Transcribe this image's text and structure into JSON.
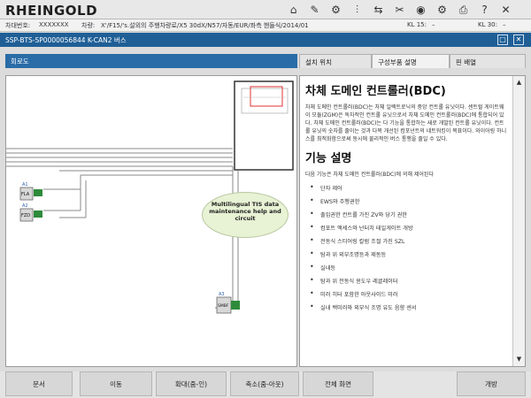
{
  "app": {
    "brand": "RHEINGOLD"
  },
  "toolbar": {
    "icons": [
      "home-icon",
      "wrench-icon",
      "car-icon",
      "chart-icon",
      "swap-icon",
      "tools-icon",
      "camera-icon",
      "gear-icon",
      "printer-icon",
      "help-icon",
      "close-icon"
    ],
    "glyphs": [
      "⌂",
      "✎",
      "⚙",
      "⫶",
      "⇆",
      "✂",
      "◉",
      "⚙",
      "⎙",
      "?",
      "✕"
    ]
  },
  "info": {
    "vin_label": "차대번호:",
    "vin_value": "XXXXXXX",
    "vehicle_label": "차량:",
    "vehicle_value": "X'/F15/'s.설외의 주행차량로/X5 30dX/N57/자동/EUR/좌측 핸들식/2014/01",
    "kl15_label": "KL 15:",
    "kl15_value": "–",
    "kl30_label": "KL 30:",
    "kl30_value": "–"
  },
  "window": {
    "title": "SSP-BTS-SP0000056844 K-CAN2 버스"
  },
  "left_tab": {
    "label": "회로도"
  },
  "right_tabs": [
    {
      "label": "설치 위치"
    },
    {
      "label": "구성부품 설명"
    },
    {
      "label": "핀 배열"
    }
  ],
  "diagram": {
    "components": [
      {
        "id": "A1",
        "name": "FLA"
      },
      {
        "id": "A2",
        "name": "FZD"
      },
      {
        "id": "A3",
        "name": "SMBF"
      }
    ]
  },
  "callout": {
    "text": "Multilingual TIS data maintenance help and circuit"
  },
  "doc": {
    "heading": "차체 도메인 컨트롤러(BDC)",
    "para1": "차체 도메인 컨트롤러(BDC)는 차체 일렉트로닉의 중앙 컨트롤 유닛이다. 센트럴 게이트웨이 모듈(ZGM)은 독자적인 컨트롤 유닛으로서 차체 도메인 컨트롤러(BDC)에 통합되어 있다. 차체 도메인 컨트롤러(BDC)는 다 기능을 통합하는 새로 개발된 컨트롤 유닛이다. 컨트롤 유닛의 숫자를 줄이는 것과 다목 개선된 컴포넌트의 네트워킹이 목표이다. 와이어링 하니스를 최적화함으로써 동시에 물리적인 버스 통행을 줄일 수 있다.",
    "subheading": "기능 설명",
    "para2": "다음 기능은 차체 도메인 컨트롤러(BDC)에 의해 제어된다",
    "items": [
      "단자 제어",
      "EWS와 주행권한",
      "출입권한 컨트롤 가진 ZV와 당기 권한",
      "컴포트 액세스와 넌터치 테일게이트 개방",
      "전동식 스티어링 칼럼 조절 가진 SZL",
      "탐과 위 외부조명등과 제동등",
      "실내등",
      "탐과 위 전동식 윈도우 레귤레이터",
      "미러 히터 포함한 아웃사이드 미러",
      "실내 백미러와 외부식 조명 유도 음향 센서"
    ]
  },
  "footer": {
    "buttons": [
      "문서",
      "이동",
      "확대(줌-인)",
      "축소(줌-아웃)",
      "전체 화면",
      "개방"
    ]
  },
  "colors": {
    "title_bar": "#1f5f96",
    "tab_active": "#2a6ca7",
    "callout_bg": "#e8f2d4",
    "connector": "#2e8b3a"
  }
}
